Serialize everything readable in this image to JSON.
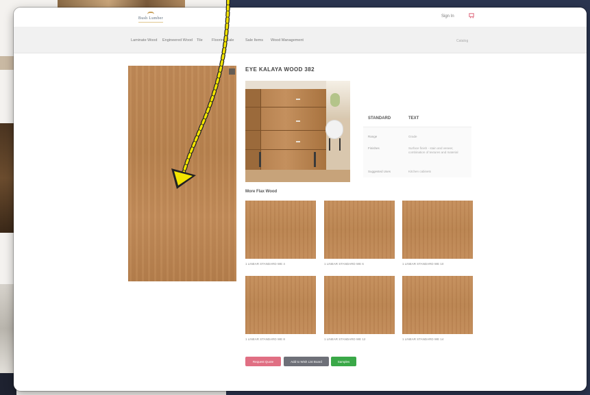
{
  "header": {
    "logo_text": "Bush Lumber",
    "top_link": "Sign In",
    "cart_icon": "cart-icon"
  },
  "nav": {
    "items": [
      "Laminate Wood",
      "Engineered Wood",
      "Tile",
      "Flooring Sale",
      "Sale Items",
      "Wood Management"
    ],
    "right_text": "Catalog"
  },
  "product": {
    "title": "EYE KALAYA WOOD 382",
    "spec": {
      "col1_header": "STANDARD",
      "col2_header": "TEXT",
      "rows": [
        {
          "label": "Range",
          "value": "Grade"
        },
        {
          "label": "Finishes",
          "value": "Surface finish - stain and veneer, combination of textures and material"
        },
        {
          "label": "Suggested Uses",
          "value": "Kitchen cabinets"
        }
      ]
    }
  },
  "related": {
    "title": "More Flax Wood",
    "items": [
      {
        "label": "1 LINEAR STANDARD WE 4"
      },
      {
        "label": "1 LINEAR STANDARD WE 6"
      },
      {
        "label": "1 LINEAR STANDARD WE 10"
      },
      {
        "label": "1 LINEAR STANDARD WE 8"
      },
      {
        "label": "1 LINEAR STANDARD WE 12"
      },
      {
        "label": "1 LINEAR STANDARD WE 14"
      }
    ]
  },
  "buttons": {
    "primary": {
      "label": "Request Quote",
      "color": "#e06f83"
    },
    "secondary": {
      "label": "Add to Wish List Board",
      "color": "#6e7078"
    },
    "tertiary": {
      "label": "Samples",
      "color": "#3aa848"
    }
  },
  "annotation": {
    "color": "#f3e400"
  }
}
